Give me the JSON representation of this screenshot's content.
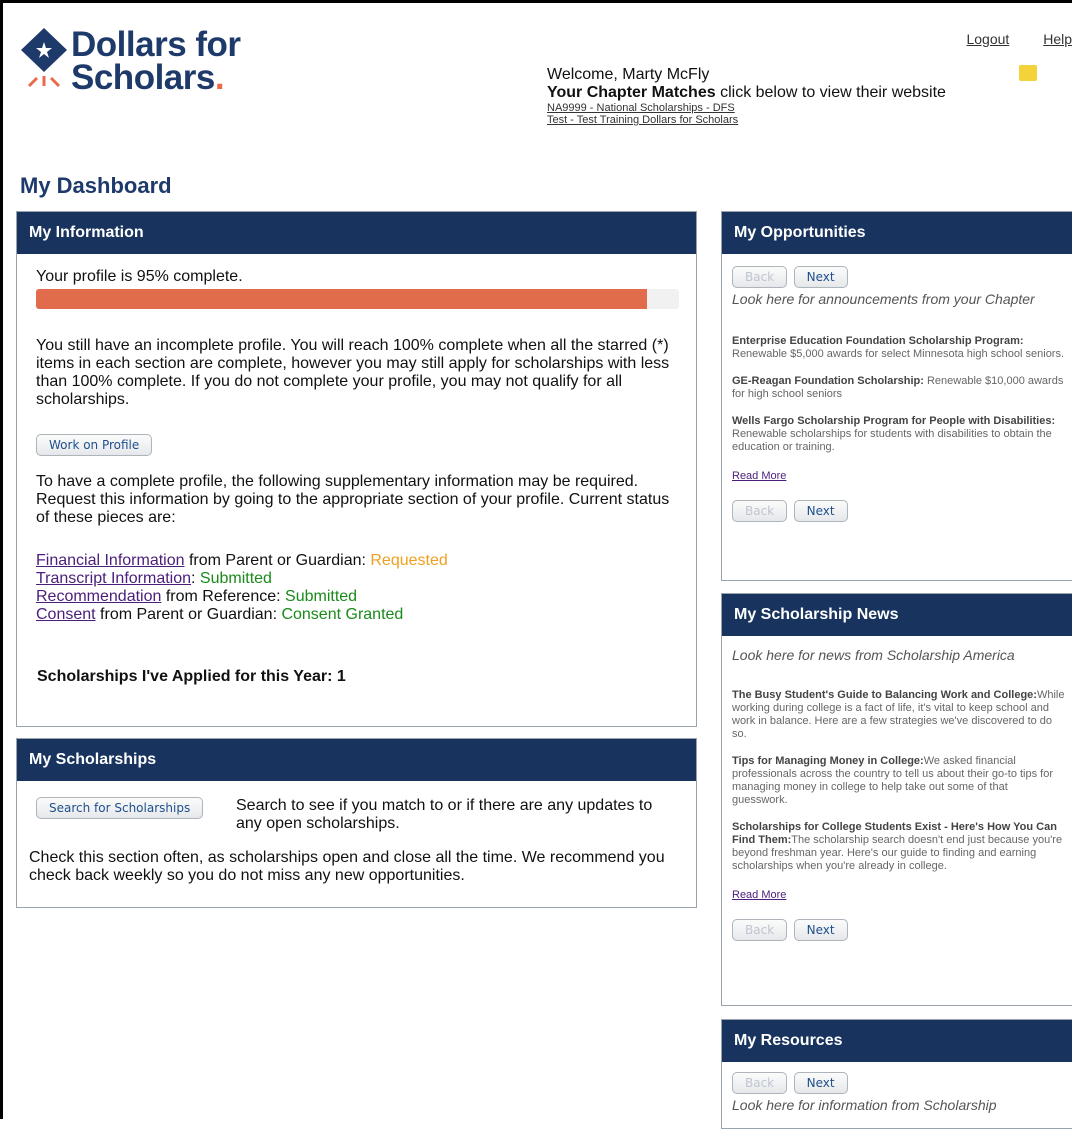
{
  "header": {
    "logo_text_line1": "Dollars for",
    "logo_text_line2": "Scholars",
    "logout": "Logout",
    "help": "Help",
    "welcome": "Welcome, Marty McFly",
    "matches_title": "Your Chapter Matches",
    "matches_desc": "click below to view their website",
    "chapter_links": [
      "NA9999 - National Scholarships - DFS",
      "Test - Test Training Dollars for Scholars"
    ]
  },
  "page_title": "My Dashboard",
  "info": {
    "title": "My Information",
    "profile_text": "Your profile is 95% complete.",
    "profile_pct": 95,
    "incomplete_text": "You still have an incomplete profile. You will reach 100% complete when all the starred (*) items in each section are complete, however you may still apply for scholarships with less than 100% complete. If you do not complete your profile, you may not qualify for all scholarships.",
    "work_button": "Work on Profile",
    "supplementary_text": "To have a complete profile, the following supplementary information may be required. Request this information by going to the appropriate section of your profile. Current status of these pieces are:",
    "status": [
      {
        "link": "Financial Information",
        "from": " from Parent or Guardian: ",
        "value": "Requested"
      },
      {
        "link": "Transcript Information",
        "from": ": ",
        "value": "Submitted"
      },
      {
        "link": "Recommendation",
        "from": " from Reference: ",
        "value": "Submitted"
      },
      {
        "link": "Consent",
        "from": " from Parent or Guardian: ",
        "value": "Consent Granted"
      }
    ],
    "applied": "Scholarships I've Applied for this Year: 1"
  },
  "scholarships": {
    "title": "My Scholarships",
    "search_button": "Search for Scholarships",
    "search_desc": "Search to see if you match to or if there are any updates to any open scholarships.",
    "note": "Check this section often, as scholarships open and close all the time. We recommend you check back weekly so you do not miss any new opportunities."
  },
  "opportunities": {
    "title": "My Opportunities",
    "back": "Back",
    "next": "Next",
    "intro": "Look here for announcements from your Chapter",
    "items": [
      {
        "title": "Enterprise Education Foundation Scholarship Program:",
        "text": " Renewable $5,000 awards for select Minnesota high school seniors."
      },
      {
        "title": "GE-Reagan Foundation Scholarship:",
        "text": " Renewable $10,000 awards for high school seniors"
      },
      {
        "title": "Wells Fargo Scholarship Program for People with Disabilities:",
        "text": " Renewable scholarships for students with disabilities to obtain the education or training."
      }
    ],
    "read_more": "Read More"
  },
  "news": {
    "title": "My Scholarship News",
    "intro": "Look here for news from Scholarship America",
    "items": [
      {
        "title": "The Busy Student's Guide to Balancing Work and College:",
        "text": "While working during college is a fact of life, it's vital to keep school and work in balance. Here are a few strategies we've discovered to do so."
      },
      {
        "title": "Tips for Managing Money in College:",
        "text": "We asked financial professionals across the country to tell us about their go-to tips for managing money in college to help take out some of that guesswork."
      },
      {
        "title": "Scholarships for College Students Exist - Here's How You Can Find Them:",
        "text": "The scholarship search doesn't end just because you're beyond freshman year. Here's our guide to finding and earning scholarships when you're already in college."
      }
    ],
    "read_more": "Read More",
    "back": "Back",
    "next": "Next"
  },
  "resources": {
    "title": "My Resources",
    "back": "Back",
    "next": "Next",
    "intro": "Look here for information from Scholarship"
  }
}
